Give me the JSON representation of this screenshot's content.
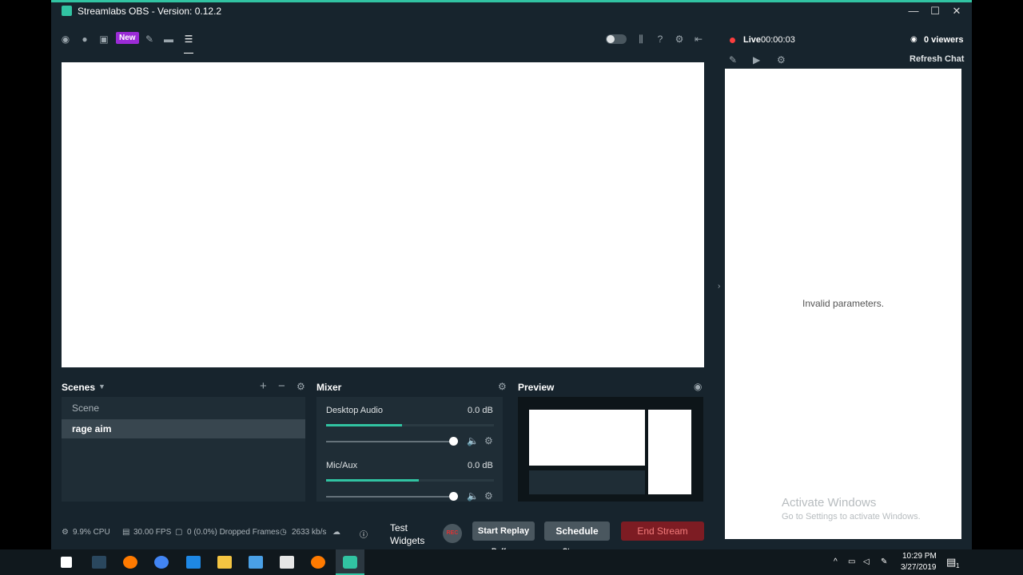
{
  "window": {
    "title": "Streamlabs OBS - Version: 0.12.2",
    "controls": [
      "—",
      "☐",
      "✕"
    ]
  },
  "toolbar": {
    "new_badge": "New"
  },
  "scenes": {
    "title": "Scenes",
    "items": [
      "Scene",
      "rage aim"
    ]
  },
  "mixer": {
    "title": "Mixer",
    "channels": [
      {
        "name": "Desktop Audio",
        "db": "0.0 dB",
        "level": 0.45
      },
      {
        "name": "Mic/Aux",
        "db": "0.0 dB",
        "level": 0.55
      }
    ]
  },
  "preview_panel": {
    "title": "Preview"
  },
  "status": {
    "cpu": "9.9% CPU",
    "fps": "30.00 FPS",
    "dropped": "0 (0.0%) Dropped Frames",
    "bitrate": "2633 kb/s"
  },
  "controls": {
    "test_widgets": "Test Widgets",
    "rec": "REC",
    "start_replay": "Start Replay",
    "replay_sub": "Buffer",
    "schedule": "Schedule",
    "schedule_sub": "Stream",
    "end_stream": "End Stream"
  },
  "live": {
    "label": "Live",
    "time": "00:00:03",
    "viewers": "0 viewers",
    "refresh_chat": "Refresh Chat",
    "chat_message": "Invalid parameters."
  },
  "watermark": {
    "line1": "Activate Windows",
    "line2": "Go to Settings to activate Windows."
  },
  "taskbar": {
    "time": "10:29 PM",
    "date": "3/27/2019",
    "notif_count": "1"
  },
  "colors": {
    "accent": "#31c3a2",
    "live_dot": "#fc3e3e",
    "end_stream": "#7d1c23",
    "new_badge": "#9b2bd6"
  }
}
